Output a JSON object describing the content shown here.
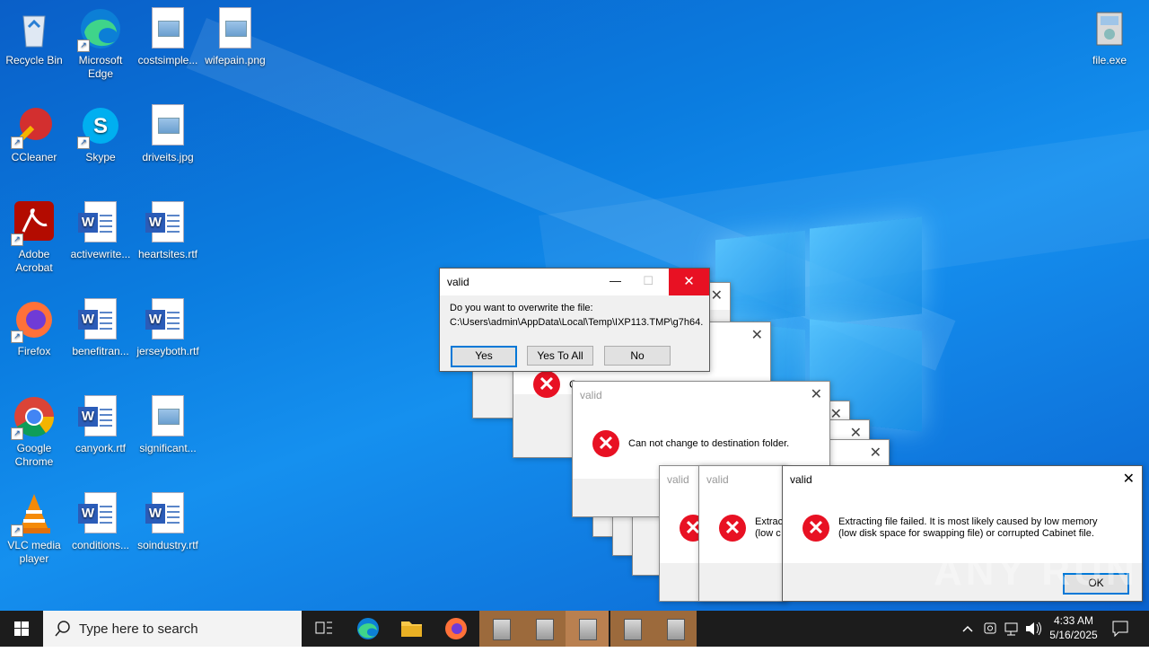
{
  "desktop_icons": [
    {
      "name": "recycle-bin",
      "label": "Recycle Bin"
    },
    {
      "name": "microsoft-edge",
      "label": "Microsoft Edge"
    },
    {
      "name": "costsimple",
      "label": "costsimple..."
    },
    {
      "name": "wifepain",
      "label": "wifepain.png"
    },
    {
      "name": "ccleaner",
      "label": "CCleaner"
    },
    {
      "name": "skype",
      "label": "Skype"
    },
    {
      "name": "driveits",
      "label": "driveits.jpg"
    },
    {
      "name": "adobe-acrobat",
      "label": "Adobe Acrobat"
    },
    {
      "name": "activewrite",
      "label": "activewrite..."
    },
    {
      "name": "heartsites",
      "label": "heartsites.rtf"
    },
    {
      "name": "firefox",
      "label": "Firefox"
    },
    {
      "name": "benefitran",
      "label": "benefitran..."
    },
    {
      "name": "jerseyboth",
      "label": "jerseyboth.rtf"
    },
    {
      "name": "google-chrome",
      "label": "Google Chrome"
    },
    {
      "name": "canyork",
      "label": "canyork.rtf"
    },
    {
      "name": "significant",
      "label": "significant..."
    },
    {
      "name": "vlc",
      "label": "VLC media player"
    },
    {
      "name": "conditions",
      "label": "conditions..."
    },
    {
      "name": "soindustry",
      "label": "soindustry.rtf"
    },
    {
      "name": "file-exe",
      "label": "file.exe"
    }
  ],
  "overwrite_dialog": {
    "title": "valid",
    "question": "Do you want to overwrite the file:",
    "path": "C:\\Users\\admin\\AppData\\Local\\Temp\\IXP113.TMP\\g7h64.",
    "yes": "Yes",
    "yes_to_all": "Yes To All",
    "no": "No",
    "minimize": "—",
    "maximize": "☐",
    "close": "✕"
  },
  "dest_dialog": {
    "title": "valid",
    "message": "Can not change to destination folder.",
    "close": "✕",
    "partial": "C"
  },
  "extract_dialog": {
    "title": "valid",
    "line1": "Extracting file failed.  It is most likely caused by low memory",
    "line2": "(low disk space for swapping file) or corrupted Cabinet file.",
    "ok": "OK",
    "close": "✕"
  },
  "stack_dialogs": {
    "title_a": "valid",
    "title_b": "valid",
    "partial_1": "Extrac",
    "partial_2": "(low c"
  },
  "close_glyph": "✕",
  "error_glyph": "✕",
  "taskbar": {
    "search_placeholder": "Type here to search",
    "time": "4:33 AM",
    "date": "5/16/2025"
  },
  "watermark": "ANY RUN"
}
